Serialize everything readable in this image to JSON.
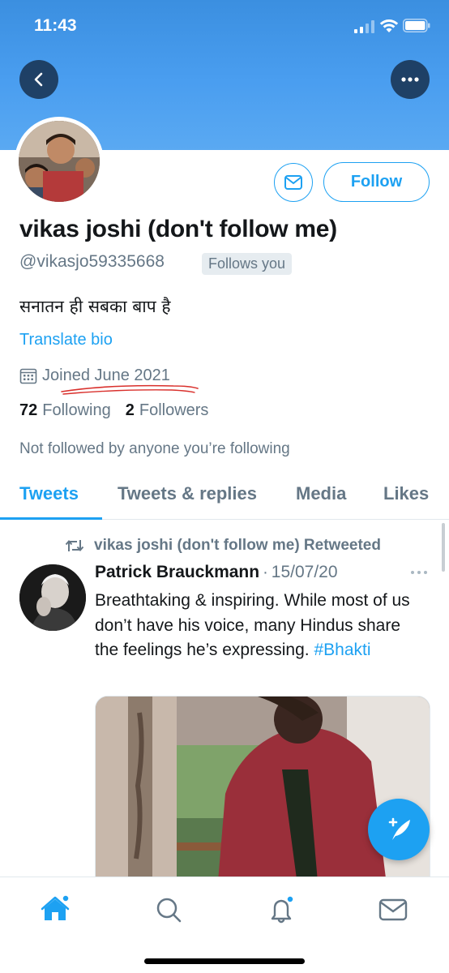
{
  "status_bar": {
    "time": "11:43"
  },
  "profile": {
    "display_name": "vikas joshi (don't follow me)",
    "handle": "@vikasjo59335668",
    "follows_you": "Follows you",
    "bio": "सनातन ही सबका बाप है",
    "translate_bio": "Translate bio",
    "joined": "Joined June 2021",
    "following_count": "72",
    "following_label": "Following",
    "followers_count": "2",
    "followers_label": "Followers",
    "not_followed": "Not followed by anyone you’re following",
    "follow_button": "Follow"
  },
  "tabs": [
    {
      "label": "Tweets",
      "active": true
    },
    {
      "label": "Tweets & replies",
      "active": false
    },
    {
      "label": "Media",
      "active": false
    },
    {
      "label": "Likes",
      "active": false
    }
  ],
  "tweet": {
    "retweet_context": "vikas joshi (don't follow me) Retweeted",
    "author": "Patrick Brauckmann",
    "separator": "·",
    "date": "15/07/20",
    "text": "Breathtaking & inspiring.  While most of us don’t have his voice, many Hindus share the feelings he’s expressing.",
    "hashtag": "#Bhakti"
  },
  "icons": {
    "back": "chevron-left-icon",
    "more": "more-horizontal-icon",
    "message": "envelope-icon",
    "calendar": "calendar-icon",
    "retweet": "retweet-icon",
    "compose": "compose-tweet-icon",
    "tabbar": [
      "home-icon",
      "search-icon",
      "notifications-icon",
      "messages-icon"
    ]
  },
  "colors": {
    "accent": "#1da1f2",
    "secondary_text": "#657786",
    "banner": "#4a9ef0"
  }
}
